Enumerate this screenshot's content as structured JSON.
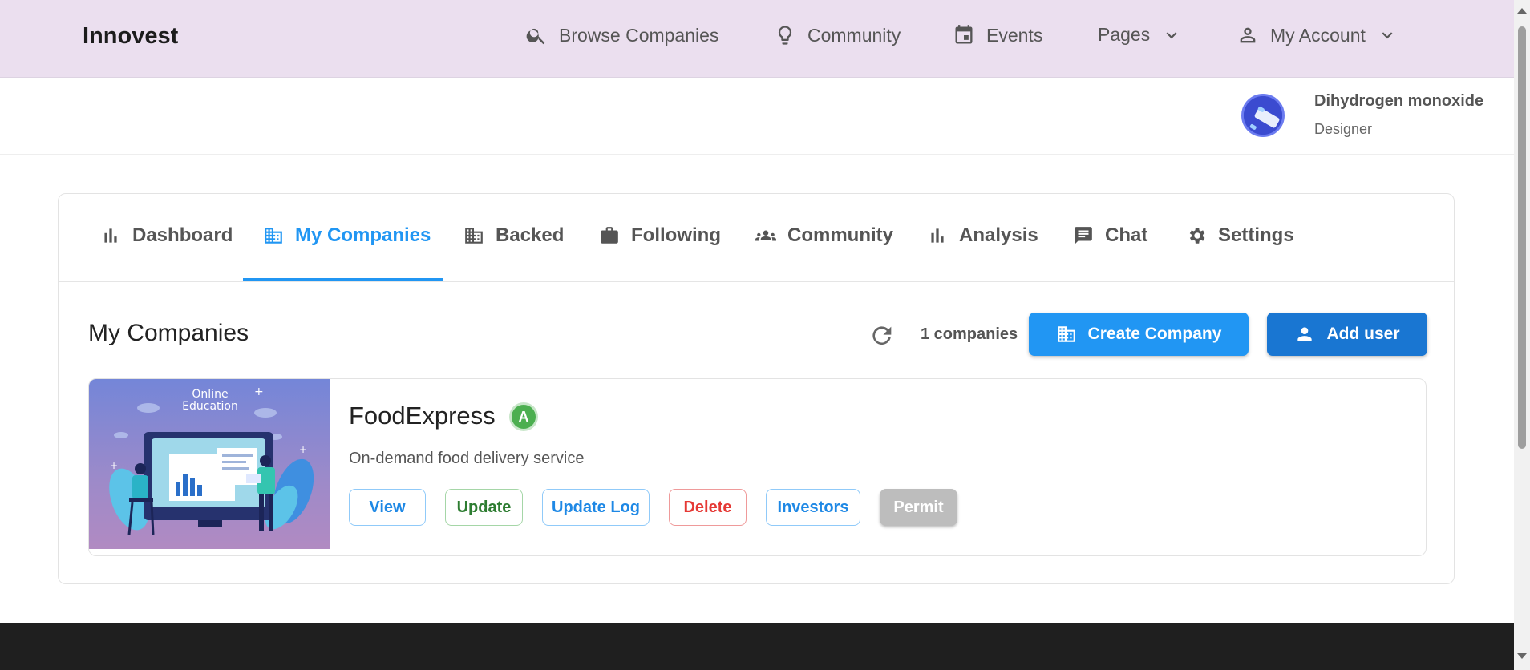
{
  "topbar": {
    "brand": "Innovest",
    "nav": {
      "browse": "Browse Companies",
      "community": "Community",
      "events": "Events",
      "pages": "Pages",
      "account": "My Account"
    }
  },
  "user": {
    "name": "Dihydrogen monoxide",
    "role": "Designer"
  },
  "tabs": [
    {
      "label": "Dashboard",
      "icon": "bar-chart-icon"
    },
    {
      "label": "My Companies",
      "icon": "building-icon",
      "active": true
    },
    {
      "label": "Backed",
      "icon": "building-icon"
    },
    {
      "label": "Following",
      "icon": "briefcase-icon"
    },
    {
      "label": "Community",
      "icon": "people-icon"
    },
    {
      "label": "Analysis",
      "icon": "bar-chart-icon"
    },
    {
      "label": "Chat",
      "icon": "chat-icon"
    },
    {
      "label": "Settings",
      "icon": "gear-icon"
    }
  ],
  "main": {
    "title": "My Companies",
    "count": "1 companies",
    "create_label": "Create Company",
    "add_user_label": "Add user"
  },
  "company": {
    "name": "FoodExpress",
    "badge": "A",
    "description": "On-demand food delivery service",
    "thumbnail_text": "Online Education",
    "actions": {
      "view": "View",
      "update": "Update",
      "update_log": "Update Log",
      "delete": "Delete",
      "investors": "Investors",
      "permit": "Permit"
    }
  },
  "colors": {
    "accent": "#2196f3",
    "topbar_bg": "#ebdfef",
    "footer_bg": "#1f1f1f",
    "badge_green": "#4caf50"
  }
}
